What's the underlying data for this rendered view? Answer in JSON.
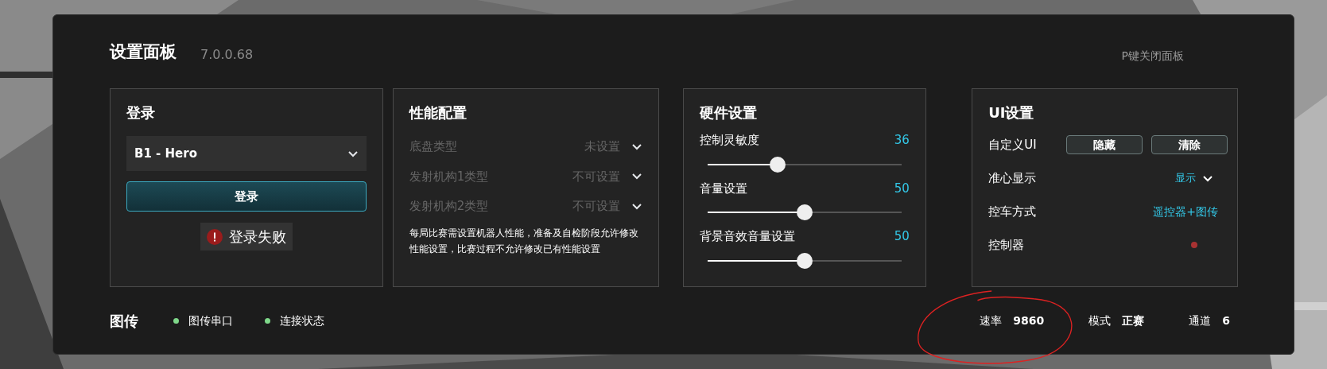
{
  "header": {
    "title": "设置面板",
    "version": "7.0.0.68",
    "hint": "P键关闭面板"
  },
  "login": {
    "title": "登录",
    "robot": "B1 - Hero",
    "button": "登录",
    "error": "登录失败"
  },
  "performance": {
    "title": "性能配置",
    "rows": [
      {
        "label": "底盘类型",
        "value": "未设置",
        "disabled": true
      },
      {
        "label": "发射机构1类型",
        "value": "不可设置",
        "disabled": true
      },
      {
        "label": "发射机构2类型",
        "value": "不可设置",
        "disabled": true
      }
    ],
    "note": "每局比赛需设置机器人性能，准备及自检阶段允许修改性能设置，比赛过程不允许修改已有性能设置"
  },
  "hardware": {
    "title": "硬件设置",
    "sliders": [
      {
        "label": "控制灵敏度",
        "reading": "36",
        "level": 0.36
      },
      {
        "label": "音量设置",
        "reading": "50",
        "level": 0.5
      },
      {
        "label": "背景音效音量设置",
        "reading": "50",
        "level": 0.5
      }
    ]
  },
  "ui": {
    "title": "UI设置",
    "rows": [
      {
        "kind": "buttons",
        "label": "自定义UI",
        "buttons": [
          "隐藏",
          "清除"
        ]
      },
      {
        "kind": "dropdown",
        "label": "准心显示",
        "value": "显示"
      },
      {
        "kind": "value",
        "label": "控车方式",
        "value": "遥控器+图传"
      },
      {
        "kind": "dot",
        "label": "控制器",
        "color": "#a83232"
      }
    ]
  },
  "footer": {
    "title": "图传",
    "indicators": [
      {
        "label": "图传串口",
        "color": "#7fd88a"
      },
      {
        "label": "连接状态",
        "color": "#7fd88a"
      }
    ],
    "stats": [
      {
        "label": "速率",
        "value": "9860"
      },
      {
        "label": "模式",
        "value": "正赛"
      },
      {
        "label": "通道",
        "value": "6"
      }
    ]
  }
}
